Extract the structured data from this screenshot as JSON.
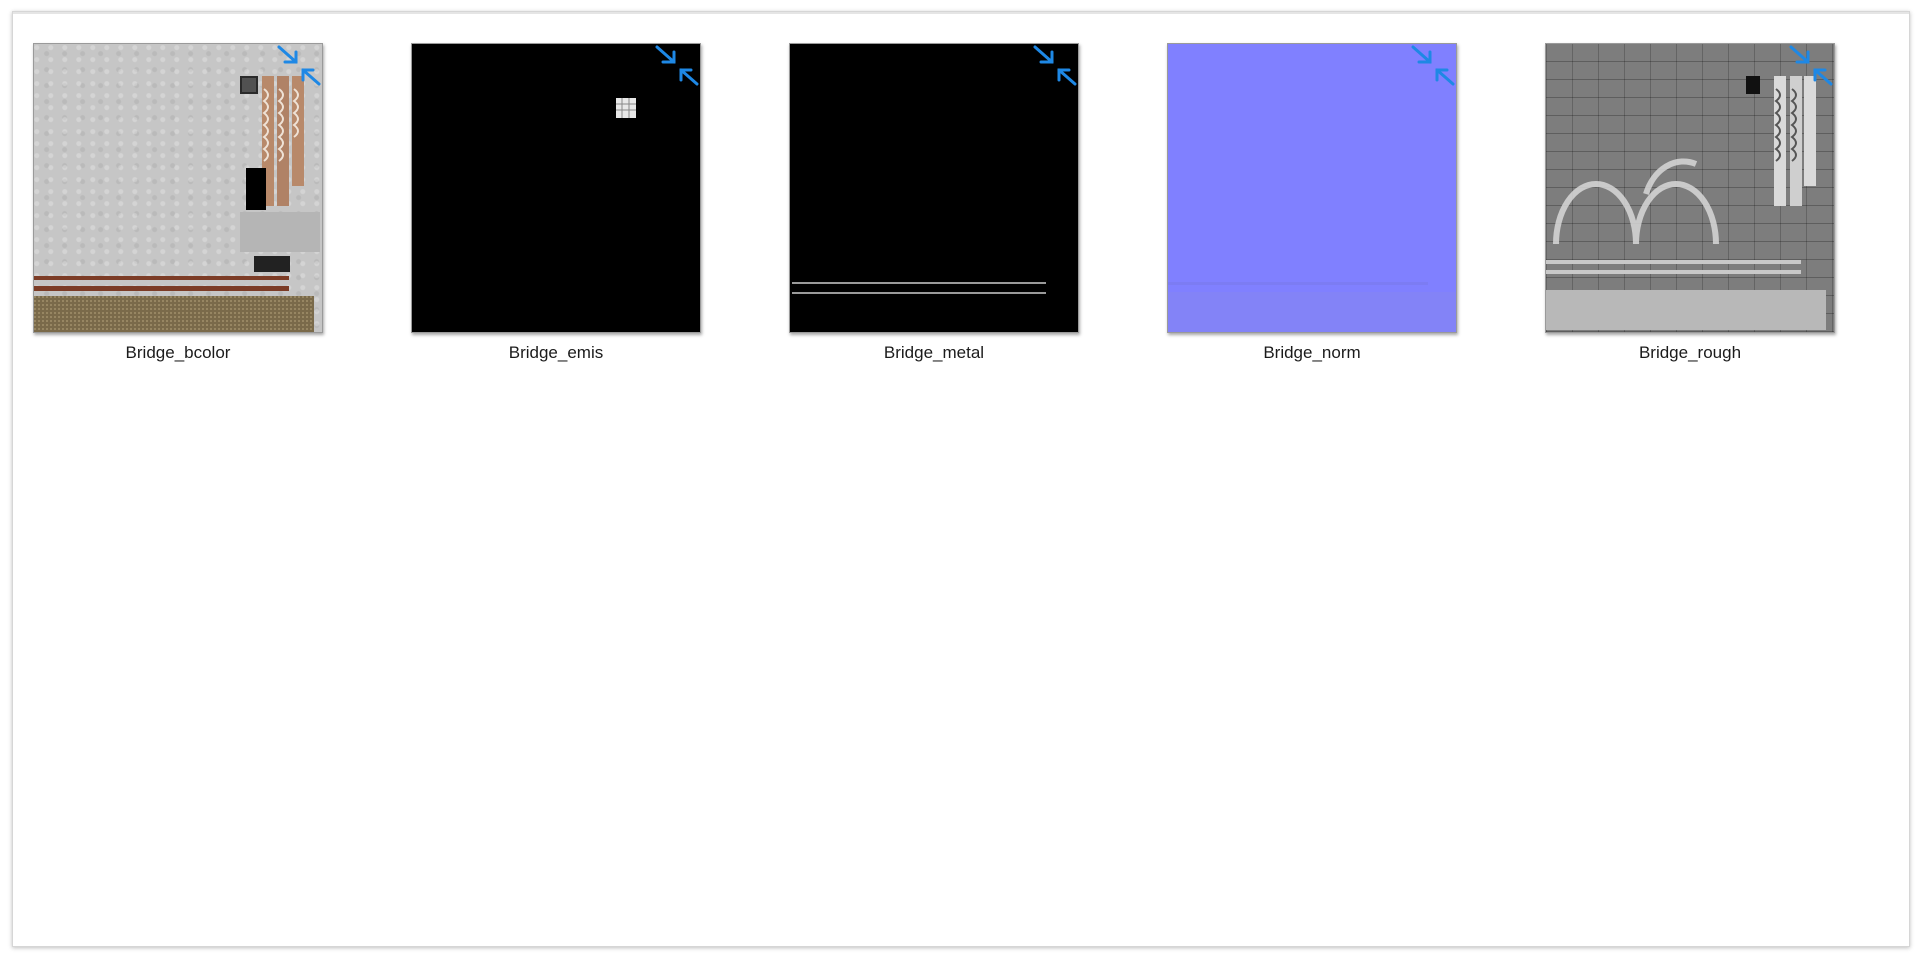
{
  "files": [
    {
      "name": "Bridge_bcolor",
      "thumb_color": "#c6c6c6"
    },
    {
      "name": "Bridge_emis",
      "thumb_color": "#000000"
    },
    {
      "name": "Bridge_metal",
      "thumb_color": "#000000"
    },
    {
      "name": "Bridge_norm",
      "thumb_color": "#8080ff"
    },
    {
      "name": "Bridge_rough",
      "thumb_color": "#7d7d7d"
    }
  ],
  "colors": {
    "shortcut_arrow": "#1e88e5",
    "label_text": "#1b1b1b"
  },
  "icons": {
    "overlay": "compress-arrows-icon"
  }
}
